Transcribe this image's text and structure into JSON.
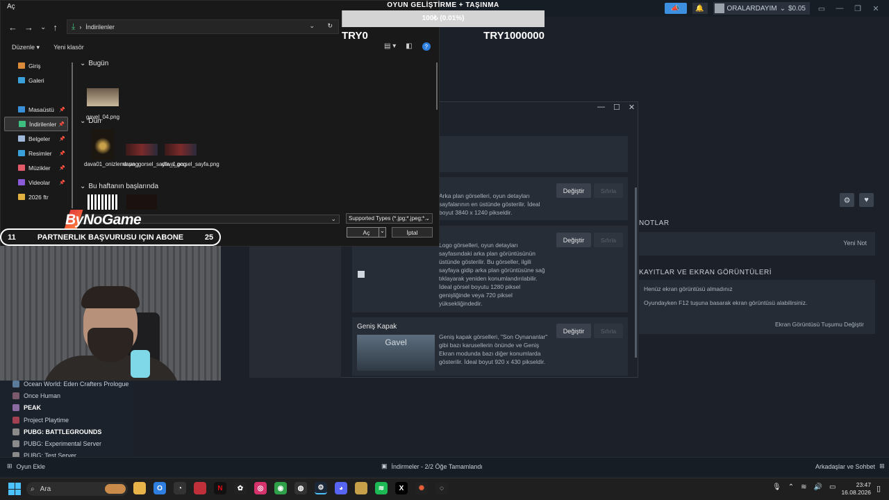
{
  "dialog": {
    "title": "Aç",
    "address": "İndirilenler",
    "toolbar": {
      "organize": "Düzenle",
      "new_folder": "Yeni klasör"
    },
    "nav": [
      {
        "label": "Giriş",
        "color": "#d98a3a"
      },
      {
        "label": "Galeri",
        "color": "#3aa0d9"
      },
      {
        "label": "Masaüstü",
        "color": "#3a8fd9"
      },
      {
        "label": "İndirilenler",
        "color": "#3fbf7f"
      },
      {
        "label": "Belgeler",
        "color": "#9fb7d9"
      },
      {
        "label": "Resimler",
        "color": "#3aa0d9"
      },
      {
        "label": "Müzikler",
        "color": "#e05a6a"
      },
      {
        "label": "Videolar",
        "color": "#8a5ad9"
      },
      {
        "label": "2026 ftr",
        "color": "#e0b040"
      }
    ],
    "groups": {
      "today": "Bugün",
      "yesterday": "Dün",
      "this_week": "Bu haftanın başlarında"
    },
    "files": {
      "f1": "gavel_04.png",
      "f2": "dava01_onizleme.png",
      "f3": "dava_gorsel_sayfa_1.png",
      "f4": "dava_gorsel_sayfa.png"
    },
    "type_filter": "Supported Types (*.jpg;*.jpeg;*.",
    "open_label": "Aç",
    "cancel_label": "İptal"
  },
  "overlay": {
    "title": "OYUN GELİŞTİRME + TAŞINMA",
    "progress_label": "100₺ (0.01%)",
    "progress_percent": 0.01,
    "min_label": "TRY0",
    "max_label": "TRY1000000"
  },
  "branding": {
    "logo": "ByNoGame"
  },
  "banner": {
    "left_num": "11",
    "message": "PARTNERLIK BAŞVURUSU IÇIN ABONE",
    "right_num": "25"
  },
  "steam_top": {
    "user": "ORALARDAYIM",
    "balance": "$0.05"
  },
  "custom": {
    "card1_text": "Arka plan görselleri, oyun detayları sayfalarının en üstünde gösterilir. İdeal boyut 3840 x 1240 pikseldir.",
    "card2_text": "Logo görselleri, oyun detayları sayfasındaki arka plan görüntüsünün üstünde gösterilir. Bu görseller, ilgili sayfaya gidip arka plan görüntüsüne sağ tıklayarak yeniden konumlandırılabilir. İdeal görsel boyutu 1280 piksel genişliğinde veya 720 piksel yüksekliğindedir.",
    "card3_title": "Geniş Kapak",
    "card3_text": "Geniş kapak görselleri, \"Son Oynananlar\" gibi bazı karusellerin önünde ve Geniş Ekran modunda bazı diğer konumlarda gösterilir. İdeal boyut 920 x 430 pikseldir.",
    "card3_preview": "Gavel",
    "change_label": "Değiştir",
    "reset_label": "Sıfırla"
  },
  "right_panel": {
    "notes_title": "NOTLAR",
    "new_note": "Yeni Not",
    "shots_title": "KAYITLAR VE EKRAN GÖRÜNTÜLERİ",
    "no_shots": "Henüz ekran görüntüsü almadınız",
    "hint": "Oyundayken F12 tuşuna basarak ekran görüntüsü alabilirsiniz.",
    "change_key": "Ekran Görüntüsü Tuşumu Değiştir"
  },
  "games": [
    {
      "name": "Ocean World: Eden Crafters Prologue",
      "bold": false,
      "color": "#5a7a9a"
    },
    {
      "name": "Once Human",
      "bold": false,
      "color": "#7a5a6a"
    },
    {
      "name": "PEAK",
      "bold": true,
      "color": "#8a6aa0"
    },
    {
      "name": "Project Playtime",
      "bold": false,
      "color": "#a04050"
    },
    {
      "name": "PUBG: BATTLEGROUNDS",
      "bold": true,
      "color": "#8a8a8a"
    },
    {
      "name": "PUBG: Experimental Server",
      "bold": false,
      "color": "#8a8a8a"
    },
    {
      "name": "PUBG: Test Server",
      "bold": false,
      "color": "#8a8a8a"
    }
  ],
  "steam_bottom": {
    "add_game": "Oyun Ekle",
    "downloads": "İndirmeler - 2/2 Öğe Tamamlandı",
    "friends": "Arkadaşlar ve Sohbet"
  },
  "taskbar": {
    "search": "Ara",
    "time": "23:47",
    "date": "16.08.2026"
  }
}
